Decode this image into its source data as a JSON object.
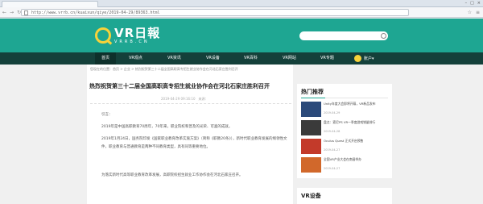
{
  "browser": {
    "url": "http://www.vrrb.cn/kuaixun/qiye/2019-04-29/89363.html"
  },
  "site": {
    "logo_title": "VR日報",
    "logo_sub": "VRRB.CN",
    "brand_color": "#1ea692",
    "nav": [
      "首页",
      "VR观点",
      "VR资讯",
      "VR设备",
      "VR百科",
      "VR网站",
      "VR专题"
    ],
    "user_label": "账户"
  },
  "article": {
    "breadcrumb": "您现在的位置：首页 > 企业 > 热烈祝贺第三十二届全国高职高专招生就业协作会在河北石家庄胜利召开",
    "title": "热烈祝贺第三十二届全国高职高专招生就业协作会在河北石家庄胜利召开",
    "meta": "2019-04-29 09:16:10　来源：",
    "paragraphs": [
      "引言：",
      "2019年是中国高职教育70周年，70年来，职业院校和普及的光荣、可喜的成就。",
      "2019年1月24日，国务院印发《国家职业教育改革实施方案》（简称《职教20条》），新时代职业教育发展的纲领性文件，职业教育与普通教育是两种不同教育类型，具有同等重要地位。",
      "为落实新时代高等职业教育改革发展，高职院校招生就业工作协作会在河北石家庄召开。"
    ]
  },
  "sidebar": {
    "heading": "热门推荐",
    "items": [
      {
        "title": "Unity年度大会即将开幕，VR新品发布",
        "date": "2019-04-29",
        "color": "#2b4a7a"
      },
      {
        "title": "盘点：索尼PS VR一季度游戏销量排行",
        "date": "2019-04-28",
        "color": "#3a3a3a"
      },
      {
        "title": "Oculus Quest 正式开启预售",
        "date": "2019-04-27",
        "color": "#c33a2a"
      },
      {
        "title": "全国VR产业大会在南昌举办",
        "date": "2019-04-27",
        "color": "#d1682b"
      }
    ]
  },
  "sidebar2": {
    "heading": "VR设备"
  }
}
